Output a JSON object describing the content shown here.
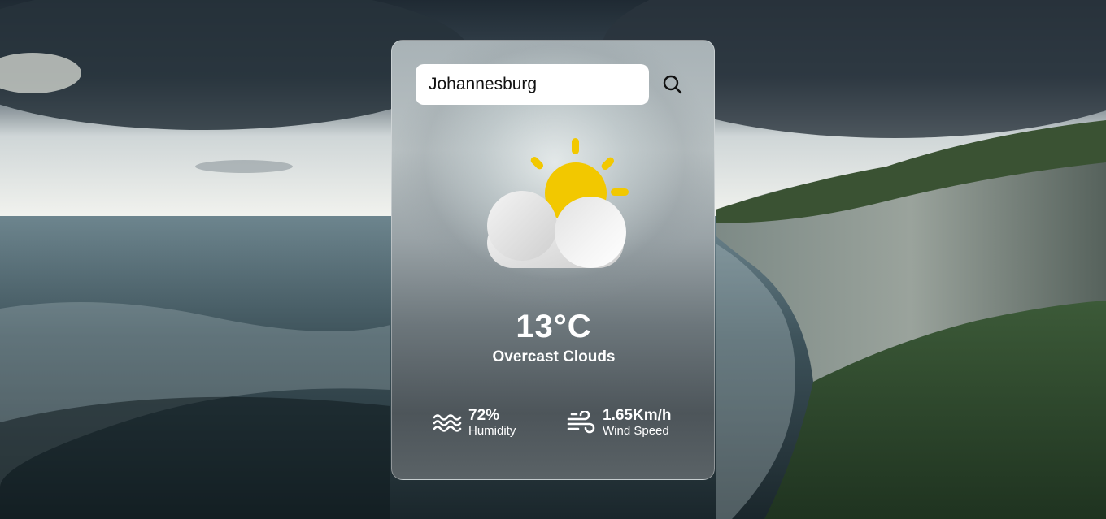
{
  "search": {
    "value": "Johannesburg",
    "placeholder": ""
  },
  "weather": {
    "icon": "partly-cloudy-icon",
    "temperature": "13°C",
    "description": "Overcast Clouds"
  },
  "details": {
    "humidity": {
      "icon": "waves-icon",
      "value": "72%",
      "label": "Humidity"
    },
    "wind": {
      "icon": "wind-icon",
      "value": "1.65Km/h",
      "label": "Wind Speed"
    }
  },
  "colors": {
    "sun": "#f2c200",
    "card_border": "#c8d0d3",
    "text": "#ffffff"
  }
}
